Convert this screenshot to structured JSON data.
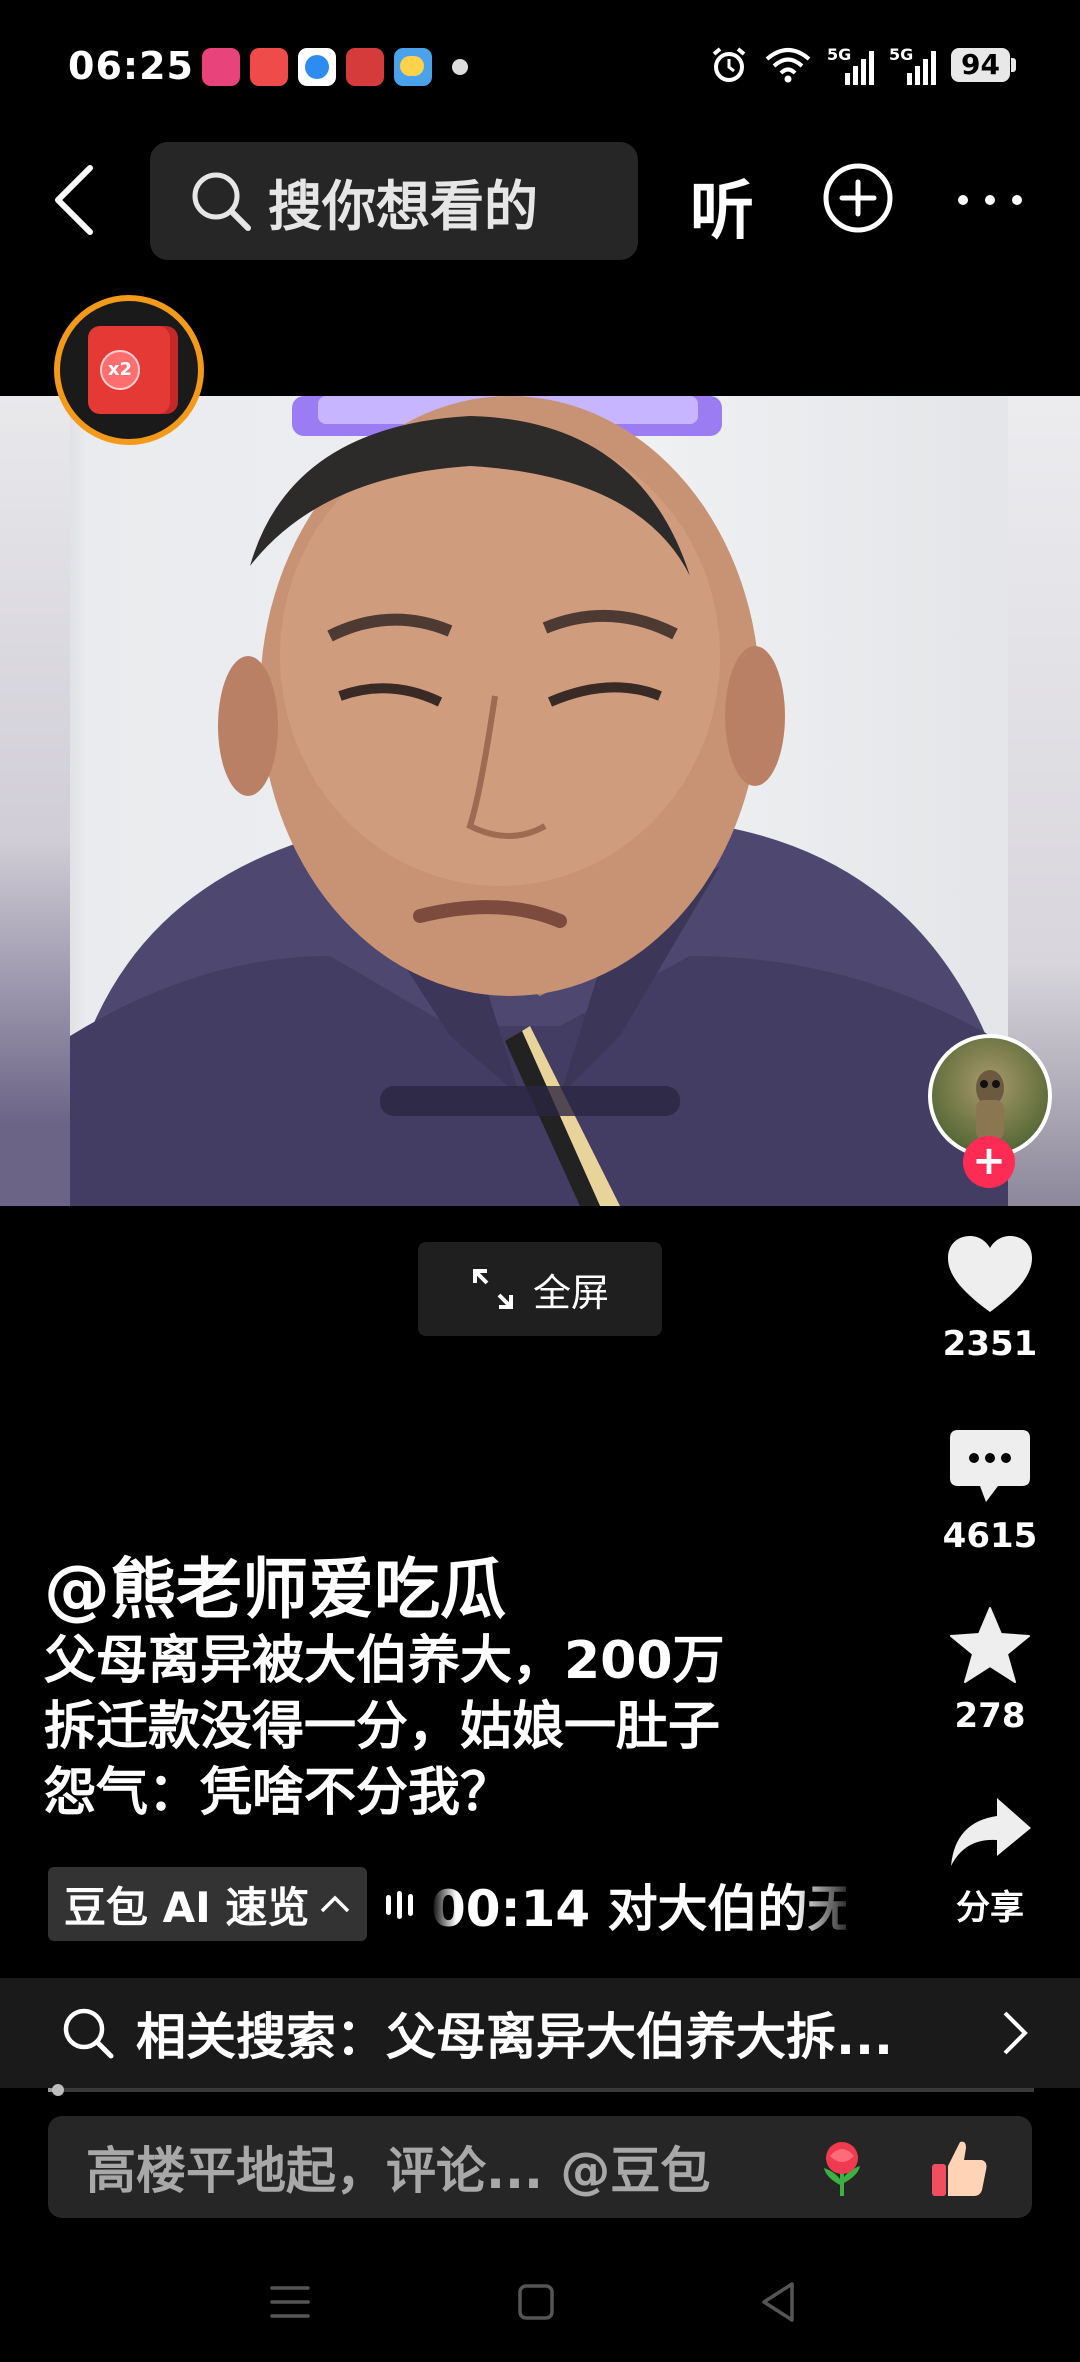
{
  "status_bar": {
    "time": "06:25",
    "battery": "94",
    "signal_1": "5G",
    "signal_2": "5G",
    "notification_icons": [
      "shop-app-icon",
      "video-app-icon",
      "browser-app-icon",
      "game-app-icon",
      "weather-app-icon"
    ]
  },
  "top_bar": {
    "search_placeholder": "搜你想看的",
    "listen_label": "听"
  },
  "red_packet": {
    "badge": "x2"
  },
  "video": {
    "fullscreen_label": "全屏"
  },
  "right_rail": {
    "like_count": "2351",
    "comment_count": "4615",
    "favorite_count": "278",
    "share_label": "分享"
  },
  "post": {
    "author": "@熊老师爱吃瓜",
    "caption_lines": [
      "父母离异被大伯养大，200万",
      "拆迁款没得一分，姑娘一肚子",
      "怨气：凭啥不分我？"
    ]
  },
  "ai_summary": {
    "chip_label": "豆包 AI 速览",
    "ticker_text": "00:14 对大伯的无"
  },
  "related_search": {
    "label": "相关搜索：父母离异大伯养大拆..."
  },
  "playback": {
    "progress": 0.01
  },
  "comment_bar": {
    "placeholder": "高楼平地起，评论... @豆包"
  },
  "colors": {
    "accent_red": "#fe2c55",
    "packet_ring": "#f39a1a",
    "background": "#000000"
  }
}
